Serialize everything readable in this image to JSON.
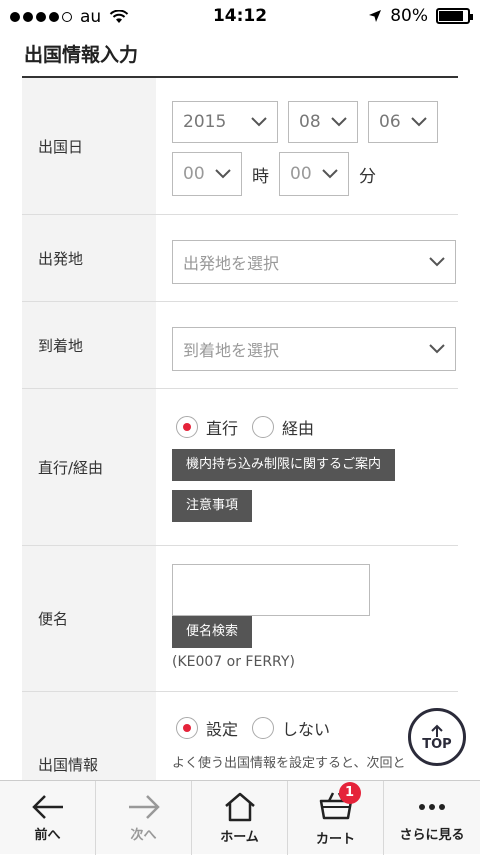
{
  "status": {
    "carrier": "au",
    "time": "14:12",
    "battery": "80%",
    "battery_level": 0.8
  },
  "page": {
    "title": "出国情報入力"
  },
  "form": {
    "departure_date": {
      "label": "出国日",
      "year": "2015",
      "month": "08",
      "day": "06",
      "hour": "00",
      "hour_unit": "時",
      "minute": "00",
      "minute_unit": "分"
    },
    "origin": {
      "label": "出発地",
      "placeholder": "出発地を選択"
    },
    "destination": {
      "label": "到着地",
      "placeholder": "到着地を選択"
    },
    "route": {
      "label": "直行/経由",
      "option_direct": "直行",
      "option_via": "経由",
      "selected": "直行",
      "carryon_button": "機内持ち込み制限に関するご案内",
      "notice_button": "注意事項"
    },
    "flight": {
      "label": "便名",
      "value": "",
      "search_button": "便名検索",
      "hint": "(KE007 or FERRY)"
    },
    "departure_info": {
      "label": "出国情報",
      "option_set": "設定",
      "option_none": "しない",
      "selected": "設定",
      "description": "よく使う出国情報を設定すると、次回と"
    }
  },
  "top_button": {
    "label": "TOP"
  },
  "tab_bar": {
    "back": "前へ",
    "forward": "次へ",
    "home": "ホーム",
    "cart": "カート",
    "cart_count": "1",
    "more": "さらに見る"
  }
}
